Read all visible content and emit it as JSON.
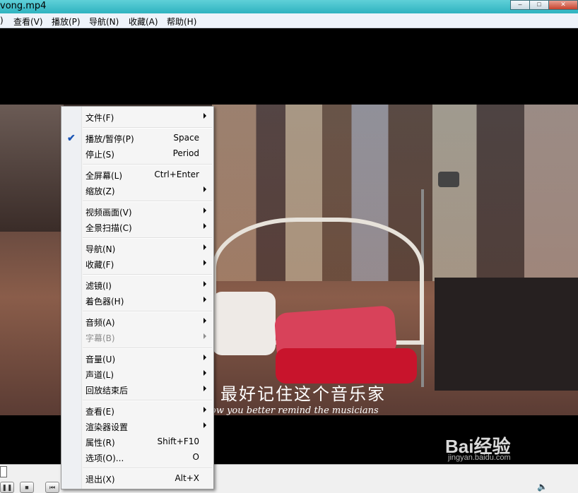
{
  "window": {
    "title": "vong.mp4"
  },
  "menubar": {
    "items": [
      {
        "label": ")"
      },
      {
        "label": "查看(V)"
      },
      {
        "label": "播放(P)"
      },
      {
        "label": "导航(N)"
      },
      {
        "label": "收藏(A)"
      },
      {
        "label": "帮助(H)"
      }
    ]
  },
  "video": {
    "subtitle_cn": "最好记住这个音乐家",
    "subtitle_en": "ow you better remind the musicians",
    "watermark": "Bai经验",
    "watermark_sub": "jingyan.baidu.com"
  },
  "context_menu": {
    "items": [
      {
        "label": "文件(F)",
        "shortcut": "",
        "submenu": true,
        "checked": false,
        "disabled": false
      },
      {
        "label": "播放/暂停(P)",
        "shortcut": "Space",
        "submenu": false,
        "checked": true,
        "disabled": false
      },
      {
        "label": "停止(S)",
        "shortcut": "Period",
        "submenu": false,
        "checked": false,
        "disabled": false
      },
      {
        "label": "全屏幕(L)",
        "shortcut": "Ctrl+Enter",
        "submenu": false,
        "checked": false,
        "disabled": false
      },
      {
        "label": "缩放(Z)",
        "shortcut": "",
        "submenu": true,
        "checked": false,
        "disabled": false
      },
      {
        "label": "视频画面(V)",
        "shortcut": "",
        "submenu": true,
        "checked": false,
        "disabled": false
      },
      {
        "label": "全景扫描(C)",
        "shortcut": "",
        "submenu": true,
        "checked": false,
        "disabled": false
      },
      {
        "label": "导航(N)",
        "shortcut": "",
        "submenu": true,
        "checked": false,
        "disabled": false
      },
      {
        "label": "收藏(F)",
        "shortcut": "",
        "submenu": true,
        "checked": false,
        "disabled": false
      },
      {
        "label": "滤镜(I)",
        "shortcut": "",
        "submenu": true,
        "checked": false,
        "disabled": false
      },
      {
        "label": "着色器(H)",
        "shortcut": "",
        "submenu": true,
        "checked": false,
        "disabled": false
      },
      {
        "label": "音频(A)",
        "shortcut": "",
        "submenu": true,
        "checked": false,
        "disabled": false
      },
      {
        "label": "字幕(B)",
        "shortcut": "",
        "submenu": true,
        "checked": false,
        "disabled": true
      },
      {
        "label": "音量(U)",
        "shortcut": "",
        "submenu": true,
        "checked": false,
        "disabled": false
      },
      {
        "label": "声道(L)",
        "shortcut": "",
        "submenu": true,
        "checked": false,
        "disabled": false
      },
      {
        "label": "回放结束后",
        "shortcut": "",
        "submenu": true,
        "checked": false,
        "disabled": false
      },
      {
        "label": "查看(E)",
        "shortcut": "",
        "submenu": true,
        "checked": false,
        "disabled": false
      },
      {
        "label": "渲染器设置",
        "shortcut": "",
        "submenu": true,
        "checked": false,
        "disabled": false
      },
      {
        "label": "属性(R)",
        "shortcut": "Shift+F10",
        "submenu": false,
        "checked": false,
        "disabled": false
      },
      {
        "label": "选项(O)...",
        "shortcut": "O",
        "submenu": false,
        "checked": false,
        "disabled": false
      },
      {
        "label": "退出(X)",
        "shortcut": "Alt+X",
        "submenu": false,
        "checked": false,
        "disabled": false
      }
    ]
  }
}
